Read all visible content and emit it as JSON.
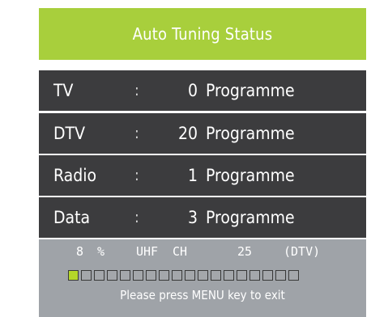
{
  "header": {
    "title": "Auto Tuning Status"
  },
  "rows": [
    {
      "label": "TV",
      "separator": ":",
      "count": "0",
      "unit": "Programme"
    },
    {
      "label": "DTV",
      "separator": ":",
      "count": "20",
      "unit": "Programme"
    },
    {
      "label": "Radio",
      "separator": ":",
      "count": "1",
      "unit": "Programme"
    },
    {
      "label": "Data",
      "separator": ":",
      "count": "3",
      "unit": "Programme"
    }
  ],
  "status": {
    "percent_value": "8",
    "percent_sign": "%",
    "band": "UHF",
    "ch_label": "CH",
    "channel": "25",
    "mode": "(DTV)"
  },
  "progress": {
    "fraction": 0.08,
    "segments_total": 18,
    "segments_filled": 1
  },
  "footer": {
    "hint": "Please press MENU key to exit"
  },
  "colors": {
    "header_bg": "#a8cf3c",
    "row_bg": "#3c3c3e",
    "footer_bg": "#9fa3a8",
    "progress_fill": "#b5d629"
  }
}
